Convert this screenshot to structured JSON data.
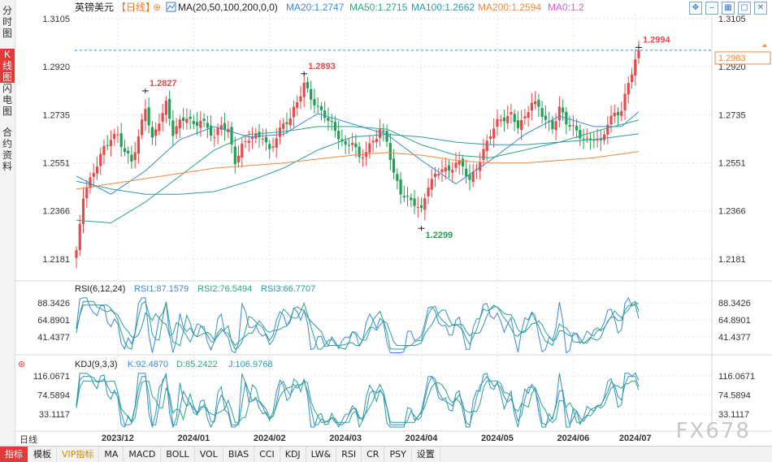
{
  "side_tabs": [
    "分时图",
    "K线图",
    "闪电图",
    "合约资料"
  ],
  "active_side_tab": 1,
  "toolbar_icons": [
    "fit-icon",
    "dash-icon",
    "grid-icon",
    "restore-icon",
    "close-icon"
  ],
  "day_line_label": "日线",
  "watermark": "FX678",
  "bottom_tabs": [
    "指标",
    "模板",
    "VIP指标",
    "MA",
    "MACD",
    "BOLL",
    "VOL",
    "BIAS",
    "CCI",
    "KDJ",
    "LW&",
    "RSI",
    "CR",
    "PSY",
    "设置"
  ],
  "active_bottom_tab": 0,
  "colors": {
    "up": "#e8494b",
    "down": "#21a055",
    "ma20": "#3e88d6",
    "ma50": "#2aa684",
    "ma100": "#2a9aa6",
    "ma200": "#ee8a3a",
    "grid": "#dfe5ee",
    "text_blue": "#3e7bd5"
  },
  "chart_data": [
    {
      "type": "candlestick",
      "title": "英镑美元",
      "period": "【日线】",
      "ma_header": "MA(20,50,100,200,0,0)",
      "legend": [
        {
          "label": "MA20:1.2747",
          "color": "#3e88d6"
        },
        {
          "label": "MA50:1.2715",
          "color": "#2aa684"
        },
        {
          "label": "MA100:1.2662",
          "color": "#2a9aa6"
        },
        {
          "label": "MA200:1.2594",
          "color": "#ee8a3a"
        },
        {
          "label": "MA0:1.2",
          "color": "#d65ad6"
        }
      ],
      "yticks": [
        1.3105,
        1.292,
        1.2735,
        1.2551,
        1.2366,
        1.2181
      ],
      "ylim": [
        1.21,
        1.312
      ],
      "xticks": [
        "2023/12",
        "2024/01",
        "2024/02",
        "2024/03",
        "2024/04",
        "2024/05",
        "2024/06",
        "2024/07"
      ],
      "last_price": 1.2983,
      "annotations": [
        {
          "label": "1.2827",
          "value": 1.2827,
          "kind": "high"
        },
        {
          "label": "1.2893",
          "value": 1.2893,
          "kind": "high"
        },
        {
          "label": "1.2299",
          "value": 1.2299,
          "kind": "low"
        },
        {
          "label": "1.2994",
          "value": 1.2994,
          "kind": "high"
        }
      ],
      "anchors": [
        [
          0,
          1.22
        ],
        [
          2,
          1.243
        ],
        [
          5,
          1.252
        ],
        [
          8,
          1.26
        ],
        [
          10,
          1.264
        ],
        [
          12,
          1.266
        ],
        [
          14,
          1.26
        ],
        [
          16,
          1.256
        ],
        [
          18,
          1.264
        ],
        [
          20,
          1.276
        ],
        [
          22,
          1.264
        ],
        [
          24,
          1.272
        ],
        [
          26,
          1.278
        ],
        [
          28,
          1.266
        ],
        [
          30,
          1.27
        ],
        [
          32,
          1.273
        ],
        [
          34,
          1.27
        ],
        [
          36,
          1.272
        ],
        [
          38,
          1.268
        ],
        [
          40,
          1.264
        ],
        [
          42,
          1.27
        ],
        [
          44,
          1.268
        ],
        [
          46,
          1.256
        ],
        [
          48,
          1.261
        ],
        [
          50,
          1.264
        ],
        [
          52,
          1.265
        ],
        [
          54,
          1.266
        ],
        [
          56,
          1.26
        ],
        [
          58,
          1.265
        ],
        [
          60,
          1.269
        ],
        [
          62,
          1.272
        ],
        [
          64,
          1.279
        ],
        [
          66,
          1.286
        ],
        [
          68,
          1.28
        ],
        [
          70,
          1.275
        ],
        [
          72,
          1.273
        ],
        [
          74,
          1.27
        ],
        [
          76,
          1.266
        ],
        [
          78,
          1.261
        ],
        [
          80,
          1.263
        ],
        [
          82,
          1.256
        ],
        [
          84,
          1.26
        ],
        [
          86,
          1.264
        ],
        [
          88,
          1.268
        ],
        [
          90,
          1.263
        ],
        [
          92,
          1.25
        ],
        [
          94,
          1.244
        ],
        [
          96,
          1.242
        ],
        [
          98,
          1.24
        ],
        [
          100,
          1.236
        ],
        [
          102,
          1.246
        ],
        [
          104,
          1.25
        ],
        [
          106,
          1.254
        ],
        [
          108,
          1.252
        ],
        [
          110,
          1.255
        ],
        [
          112,
          1.253
        ],
        [
          114,
          1.248
        ],
        [
          116,
          1.254
        ],
        [
          118,
          1.26
        ],
        [
          120,
          1.266
        ],
        [
          122,
          1.27
        ],
        [
          124,
          1.272
        ],
        [
          126,
          1.274
        ],
        [
          128,
          1.27
        ],
        [
          130,
          1.272
        ],
        [
          132,
          1.278
        ],
        [
          134,
          1.276
        ],
        [
          136,
          1.272
        ],
        [
          138,
          1.269
        ],
        [
          140,
          1.276
        ],
        [
          142,
          1.27
        ],
        [
          144,
          1.268
        ],
        [
          146,
          1.266
        ],
        [
          148,
          1.264
        ],
        [
          150,
          1.265
        ],
        [
          152,
          1.262
        ],
        [
          154,
          1.27
        ],
        [
          156,
          1.274
        ],
        [
          158,
          1.276
        ],
        [
          160,
          1.286
        ],
        [
          162,
          1.294
        ],
        [
          163,
          1.2983
        ]
      ],
      "ma_anchors": {
        "ma20": [
          [
            0,
            1.25
          ],
          [
            10,
            1.243
          ],
          [
            20,
            1.252
          ],
          [
            30,
            1.264
          ],
          [
            40,
            1.269
          ],
          [
            50,
            1.265
          ],
          [
            60,
            1.266
          ],
          [
            70,
            1.274
          ],
          [
            80,
            1.27
          ],
          [
            90,
            1.266
          ],
          [
            100,
            1.256
          ],
          [
            110,
            1.247
          ],
          [
            120,
            1.256
          ],
          [
            130,
            1.266
          ],
          [
            140,
            1.273
          ],
          [
            150,
            1.269
          ],
          [
            158,
            1.269
          ],
          [
            163,
            1.2747
          ]
        ],
        "ma50": [
          [
            0,
            1.233
          ],
          [
            10,
            1.232
          ],
          [
            20,
            1.24
          ],
          [
            30,
            1.25
          ],
          [
            40,
            1.26
          ],
          [
            50,
            1.266
          ],
          [
            60,
            1.267
          ],
          [
            70,
            1.269
          ],
          [
            80,
            1.269
          ],
          [
            90,
            1.268
          ],
          [
            100,
            1.262
          ],
          [
            110,
            1.258
          ],
          [
            120,
            1.257
          ],
          [
            130,
            1.26
          ],
          [
            140,
            1.263
          ],
          [
            150,
            1.267
          ],
          [
            163,
            1.2715
          ]
        ],
        "ma100": [
          [
            0,
            1.248
          ],
          [
            10,
            1.245
          ],
          [
            20,
            1.243
          ],
          [
            30,
            1.243
          ],
          [
            40,
            1.244
          ],
          [
            50,
            1.248
          ],
          [
            60,
            1.253
          ],
          [
            70,
            1.26
          ],
          [
            80,
            1.265
          ],
          [
            90,
            1.266
          ],
          [
            100,
            1.265
          ],
          [
            110,
            1.263
          ],
          [
            120,
            1.262
          ],
          [
            130,
            1.262
          ],
          [
            140,
            1.263
          ],
          [
            150,
            1.264
          ],
          [
            163,
            1.2662
          ]
        ],
        "ma200": [
          [
            0,
            1.245
          ],
          [
            20,
            1.249
          ],
          [
            40,
            1.253
          ],
          [
            60,
            1.255
          ],
          [
            80,
            1.258
          ],
          [
            90,
            1.259
          ],
          [
            100,
            1.258
          ],
          [
            110,
            1.256
          ],
          [
            120,
            1.255
          ],
          [
            130,
            1.255
          ],
          [
            140,
            1.256
          ],
          [
            150,
            1.257
          ],
          [
            163,
            1.2594
          ]
        ]
      }
    },
    {
      "type": "line",
      "title": "RSI(6,12,24)",
      "legend": [
        {
          "label": "RSI1:87.1579",
          "color": "#3e88d6"
        },
        {
          "label": "RSI2:76.5494",
          "color": "#2aa684"
        },
        {
          "label": "RSI3:66.7707",
          "color": "#2a9aa6"
        }
      ],
      "yticks": [
        88.3426,
        64.8901,
        41.4377
      ],
      "ylim": [
        25,
        97
      ],
      "last_values": [
        87.1579,
        76.5494,
        66.7707
      ]
    },
    {
      "type": "line",
      "title": "KDJ(9,3,3)",
      "legend": [
        {
          "label": "K:92.4870",
          "color": "#3e88d6"
        },
        {
          "label": "D:85.2422",
          "color": "#2aa684"
        },
        {
          "label": "J:106.9768",
          "color": "#2a9aa6"
        }
      ],
      "yticks": [
        116.0671,
        74.5894,
        33.1117
      ],
      "ylim": [
        5,
        125
      ],
      "last_values": [
        92.487,
        85.2422,
        106.9768
      ]
    }
  ]
}
